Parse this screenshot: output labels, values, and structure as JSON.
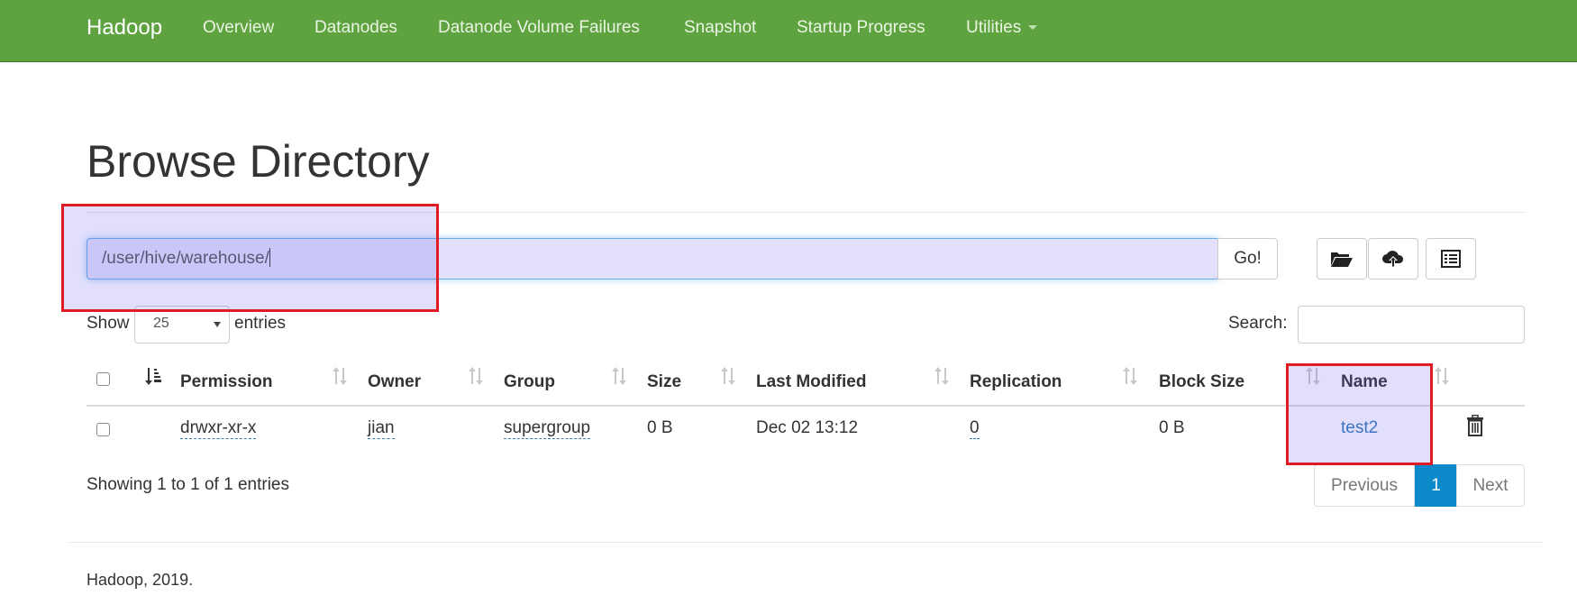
{
  "navbar": {
    "brand": "Hadoop",
    "items": [
      "Overview",
      "Datanodes",
      "Datanode Volume Failures",
      "Snapshot",
      "Startup Progress",
      "Utilities"
    ]
  },
  "page_title": "Browse Directory",
  "path": {
    "value": "/user/hive/warehouse/",
    "go_label": "Go!"
  },
  "toolbar": {
    "icons": [
      "folder-open-icon",
      "cloud-upload-icon",
      "list-alt-icon"
    ]
  },
  "length": {
    "show_label": "Show",
    "selected": "25",
    "entries_label": "entries"
  },
  "search": {
    "label": "Search:",
    "value": ""
  },
  "table": {
    "columns": [
      "Permission",
      "Owner",
      "Group",
      "Size",
      "Last Modified",
      "Replication",
      "Block Size",
      "Name"
    ],
    "rows": [
      {
        "permission": "drwxr-xr-x",
        "owner": "jian",
        "group": "supergroup",
        "size": "0 B",
        "last_modified": "Dec 02 13:12",
        "replication": "0",
        "block_size": "0 B",
        "name": "test2"
      }
    ]
  },
  "info": "Showing 1 to 1 of 1 entries",
  "pagination": {
    "previous": "Previous",
    "current": "1",
    "next": "Next"
  },
  "footer": "Hadoop, 2019.",
  "colors": {
    "navbar": "#5fa341",
    "link": "#337ab7",
    "active_page": "#0c89c9",
    "highlight_box": "#e01b24",
    "highlight_fill": "#6860f0"
  }
}
